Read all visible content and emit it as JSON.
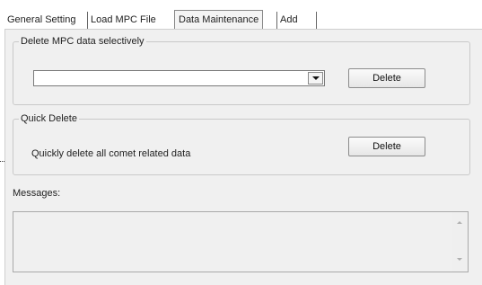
{
  "tabs": [
    {
      "label": "General Setting"
    },
    {
      "label": "Load MPC File"
    },
    {
      "label": "Data Maintenance",
      "active": true
    },
    {
      "label": "Add"
    }
  ],
  "delete_selective": {
    "legend": "Delete MPC data selectively",
    "combo_value": "",
    "button_label": "Delete"
  },
  "quick_delete": {
    "legend": "Quick Delete",
    "description": "Quickly delete all comet related data",
    "button_label": "Delete"
  },
  "messages": {
    "label": "Messages:",
    "content": ""
  },
  "icons": {
    "combo_arrow": "chevron-down-icon",
    "scroll_up": "scroll-up-icon",
    "scroll_down": "scroll-down-icon"
  }
}
